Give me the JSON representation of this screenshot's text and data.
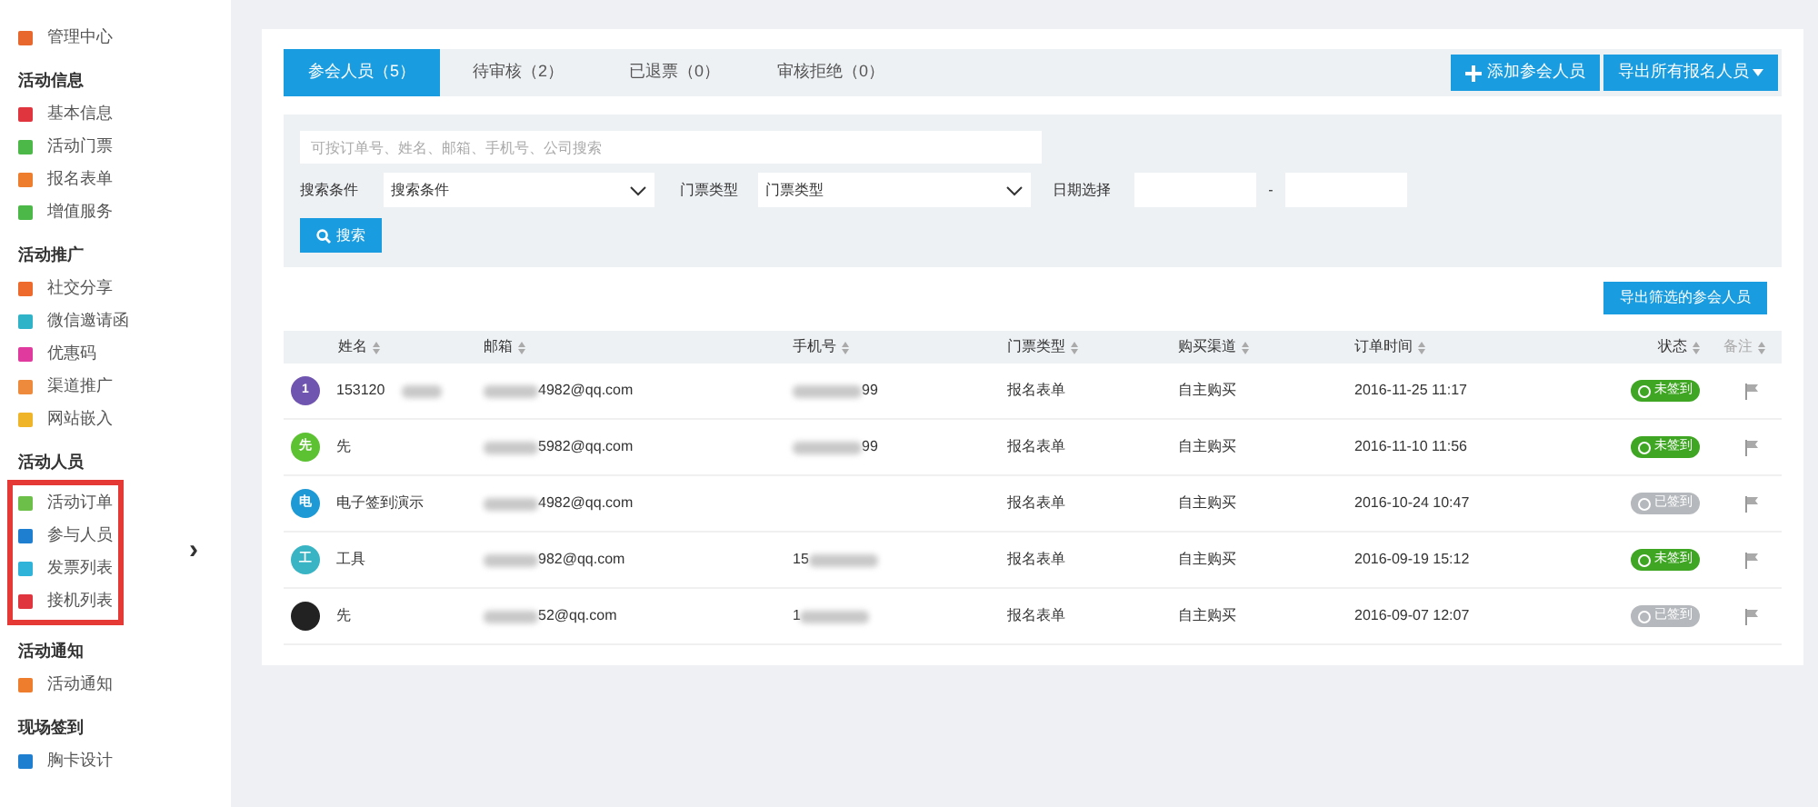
{
  "sidebar": {
    "sections": [
      {
        "items": [
          {
            "label": "管理中心",
            "color": "#e8672c"
          }
        ]
      },
      {
        "title": "活动信息",
        "items": [
          {
            "label": "基本信息",
            "color": "#e0353f"
          },
          {
            "label": "活动门票",
            "color": "#4cb848"
          },
          {
            "label": "报名表单",
            "color": "#ee7d2d"
          },
          {
            "label": "增值服务",
            "color": "#4cb848"
          }
        ]
      },
      {
        "title": "活动推广",
        "items": [
          {
            "label": "社交分享",
            "color": "#ee6a2c"
          },
          {
            "label": "微信邀请函",
            "color": "#2fb3c8"
          },
          {
            "label": "优惠码",
            "color": "#e03a9e"
          },
          {
            "label": "渠道推广",
            "color": "#ee8a3c"
          },
          {
            "label": "网站嵌入",
            "color": "#f0b429"
          }
        ]
      },
      {
        "title": "活动人员",
        "highlighted": true,
        "items": [
          {
            "label": "活动订单",
            "color": "#6cc04a"
          },
          {
            "label": "参与人员",
            "color": "#1e7fd1"
          },
          {
            "label": "发票列表",
            "color": "#2fb3d8"
          },
          {
            "label": "接机列表",
            "color": "#e0353f"
          }
        ]
      },
      {
        "title": "活动通知",
        "items": [
          {
            "label": "活动通知",
            "color": "#ee7d2d"
          }
        ]
      },
      {
        "title": "现场签到",
        "items": [
          {
            "label": "胸卡设计",
            "color": "#1e7fd1"
          }
        ]
      }
    ],
    "collapse": "›"
  },
  "tabs": [
    {
      "label": "参会人员（5）",
      "selected": true
    },
    {
      "label": "待审核（2）",
      "selected": false
    },
    {
      "label": "已退票（0）",
      "selected": false
    },
    {
      "label": "审核拒绝（0）",
      "selected": false
    }
  ],
  "actions": {
    "add": "添加参会人员",
    "export_all": "导出所有报名人员"
  },
  "filters": {
    "search_placeholder": "可按订单号、姓名、邮箱、手机号、公司搜索",
    "condition_label": "搜索条件",
    "condition_value": "搜索条件",
    "ticket_label": "门票类型",
    "ticket_value": "门票类型",
    "date_label": "日期选择",
    "date_sep": "-",
    "search_button": "搜索"
  },
  "export_filtered": "导出筛选的参会人员",
  "table": {
    "columns": [
      "姓名",
      "邮箱",
      "手机号",
      "门票类型",
      "购买渠道",
      "订单时间",
      "状态",
      "备注"
    ],
    "rows": [
      {
        "avatar": "1",
        "color": "#7055b0",
        "name": "153120",
        "email": "4982@qq.com",
        "phone": "99",
        "ticket": "报名表单",
        "channel": "自主购买",
        "time": "2016-11-25 11:17",
        "checked_in": false,
        "status": "未签到"
      },
      {
        "avatar": "先",
        "color": "#5cc232",
        "name": "先",
        "email": "5982@qq.com",
        "phone": "99",
        "ticket": "报名表单",
        "channel": "自主购买",
        "time": "2016-11-10 11:56",
        "checked_in": false,
        "status": "未签到"
      },
      {
        "avatar": "电",
        "color": "#1d9ad6",
        "name": "电子签到演示",
        "email": "4982@qq.com",
        "ticket": "报名表单",
        "channel": "自主购买",
        "time": "2016-10-24 10:47",
        "checked_in": true,
        "status": "已签到"
      },
      {
        "avatar": "工",
        "color": "#38b4c4",
        "name": "工具",
        "email": "982@qq.com",
        "phone": "15",
        "ticket": "报名表单",
        "channel": "自主购买",
        "time": "2016-09-19 15:12",
        "checked_in": false,
        "status": "未签到"
      },
      {
        "color": "#222222",
        "name": "先",
        "email": "52@qq.com",
        "phone": "1",
        "ticket": "报名表单",
        "channel": "自主购买",
        "time": "2016-09-07 12:07",
        "checked_in": true,
        "status": "已签到"
      }
    ]
  }
}
